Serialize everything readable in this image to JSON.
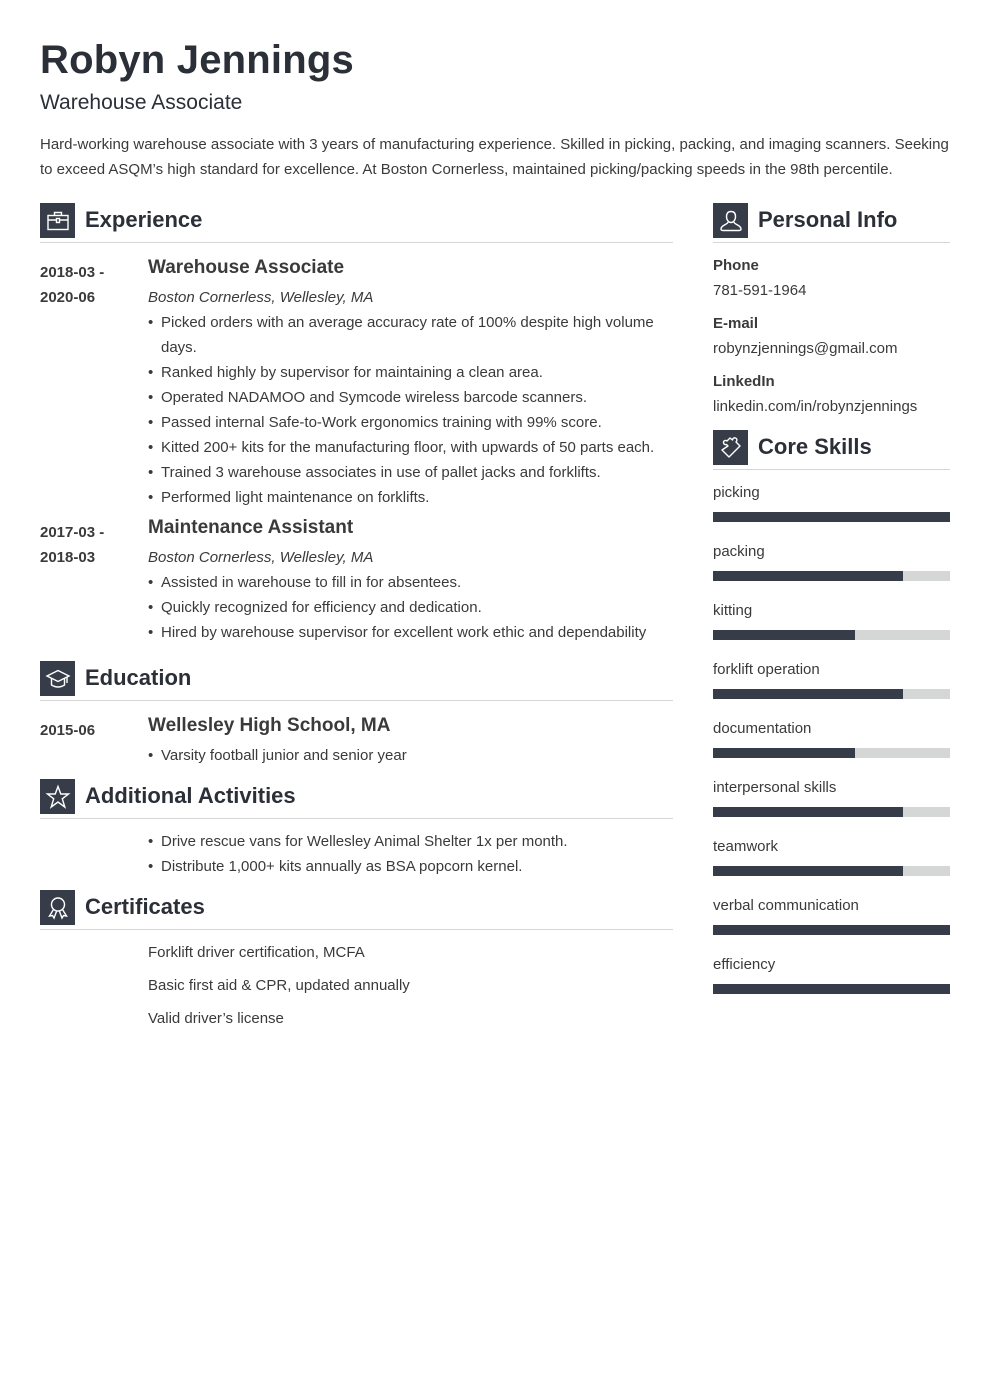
{
  "header": {
    "name": "Robyn Jennings",
    "headline": "Warehouse Associate",
    "summary": "Hard-working warehouse associate with 3 years of manufacturing experience. Skilled in picking, packing, and imaging scanners. Seeking to exceed ASQM’s high standard for excellence. At Boston Cornerless, maintained picking/packing speeds in the 98th percentile."
  },
  "colors": {
    "accent": "#373d48",
    "bar_empty": "#d5d6d6",
    "text": "#3a3a3a",
    "divider": "#d6d6d6"
  },
  "experience": {
    "title": "Experience",
    "icon": "briefcase-icon",
    "entries": [
      {
        "date_start": "2018-03 -",
        "date_end": "2020-06",
        "title": "Warehouse Associate",
        "subtitle": "Boston Cornerless, Wellesley, MA",
        "bullets": [
          "Picked orders with an average accuracy rate of 100% despite high volume days.",
          "Ranked highly by supervisor for maintaining a clean area.",
          "Operated NADAMOO and Symcode wireless barcode scanners.",
          "Passed internal Safe-to-Work ergonomics training with 99% score.",
          "Kitted 200+ kits for the manufacturing floor, with upwards of 50 parts each.",
          "Trained 3 warehouse associates in use of pallet jacks and forklifts.",
          "Performed light maintenance on forklifts."
        ]
      },
      {
        "date_start": "2017-03 -",
        "date_end": "2018-03",
        "title": "Maintenance Assistant",
        "subtitle": "Boston Cornerless, Wellesley, MA",
        "bullets": [
          "Assisted in warehouse to fill in for absentees.",
          "Quickly recognized for efficiency and dedication.",
          "Hired by warehouse supervisor for excellent work ethic and dependability"
        ]
      }
    ]
  },
  "education": {
    "title": "Education",
    "icon": "graduation-cap-icon",
    "entries": [
      {
        "date": "2015-06",
        "title": "Wellesley High School, MA",
        "bullets": [
          "Varsity football junior and senior year"
        ]
      }
    ]
  },
  "activities": {
    "title": "Additional Activities",
    "icon": "star-icon",
    "bullets": [
      "Drive rescue vans for Wellesley Animal Shelter 1x per month.",
      "Distribute 1,000+ kits annually as BSA popcorn kernel."
    ]
  },
  "certificates": {
    "title": "Certificates",
    "icon": "award-ribbon-icon",
    "items": [
      "Forklift driver certification, MCFA",
      "Basic first aid & CPR, updated annually",
      "Valid driver’s license"
    ]
  },
  "personal_info": {
    "title": "Personal Info",
    "icon": "user-icon",
    "fields": [
      {
        "label": "Phone",
        "value": "781-591-1964"
      },
      {
        "label": "E-mail",
        "value": "robynzjennings@gmail.com"
      },
      {
        "label": "LinkedIn",
        "value": "linkedin.com/in/robynzjennings"
      }
    ]
  },
  "skills": {
    "title": "Core Skills",
    "icon": "puzzle-piece-icon",
    "items": [
      {
        "name": "picking",
        "level": 1.0
      },
      {
        "name": "packing",
        "level": 0.8
      },
      {
        "name": "kitting",
        "level": 0.6
      },
      {
        "name": "forklift operation",
        "level": 0.8
      },
      {
        "name": "documentation",
        "level": 0.6
      },
      {
        "name": "interpersonal skills",
        "level": 0.8
      },
      {
        "name": "teamwork",
        "level": 0.8
      },
      {
        "name": "verbal communication",
        "level": 1.0
      },
      {
        "name": "efficiency",
        "level": 1.0
      }
    ]
  }
}
